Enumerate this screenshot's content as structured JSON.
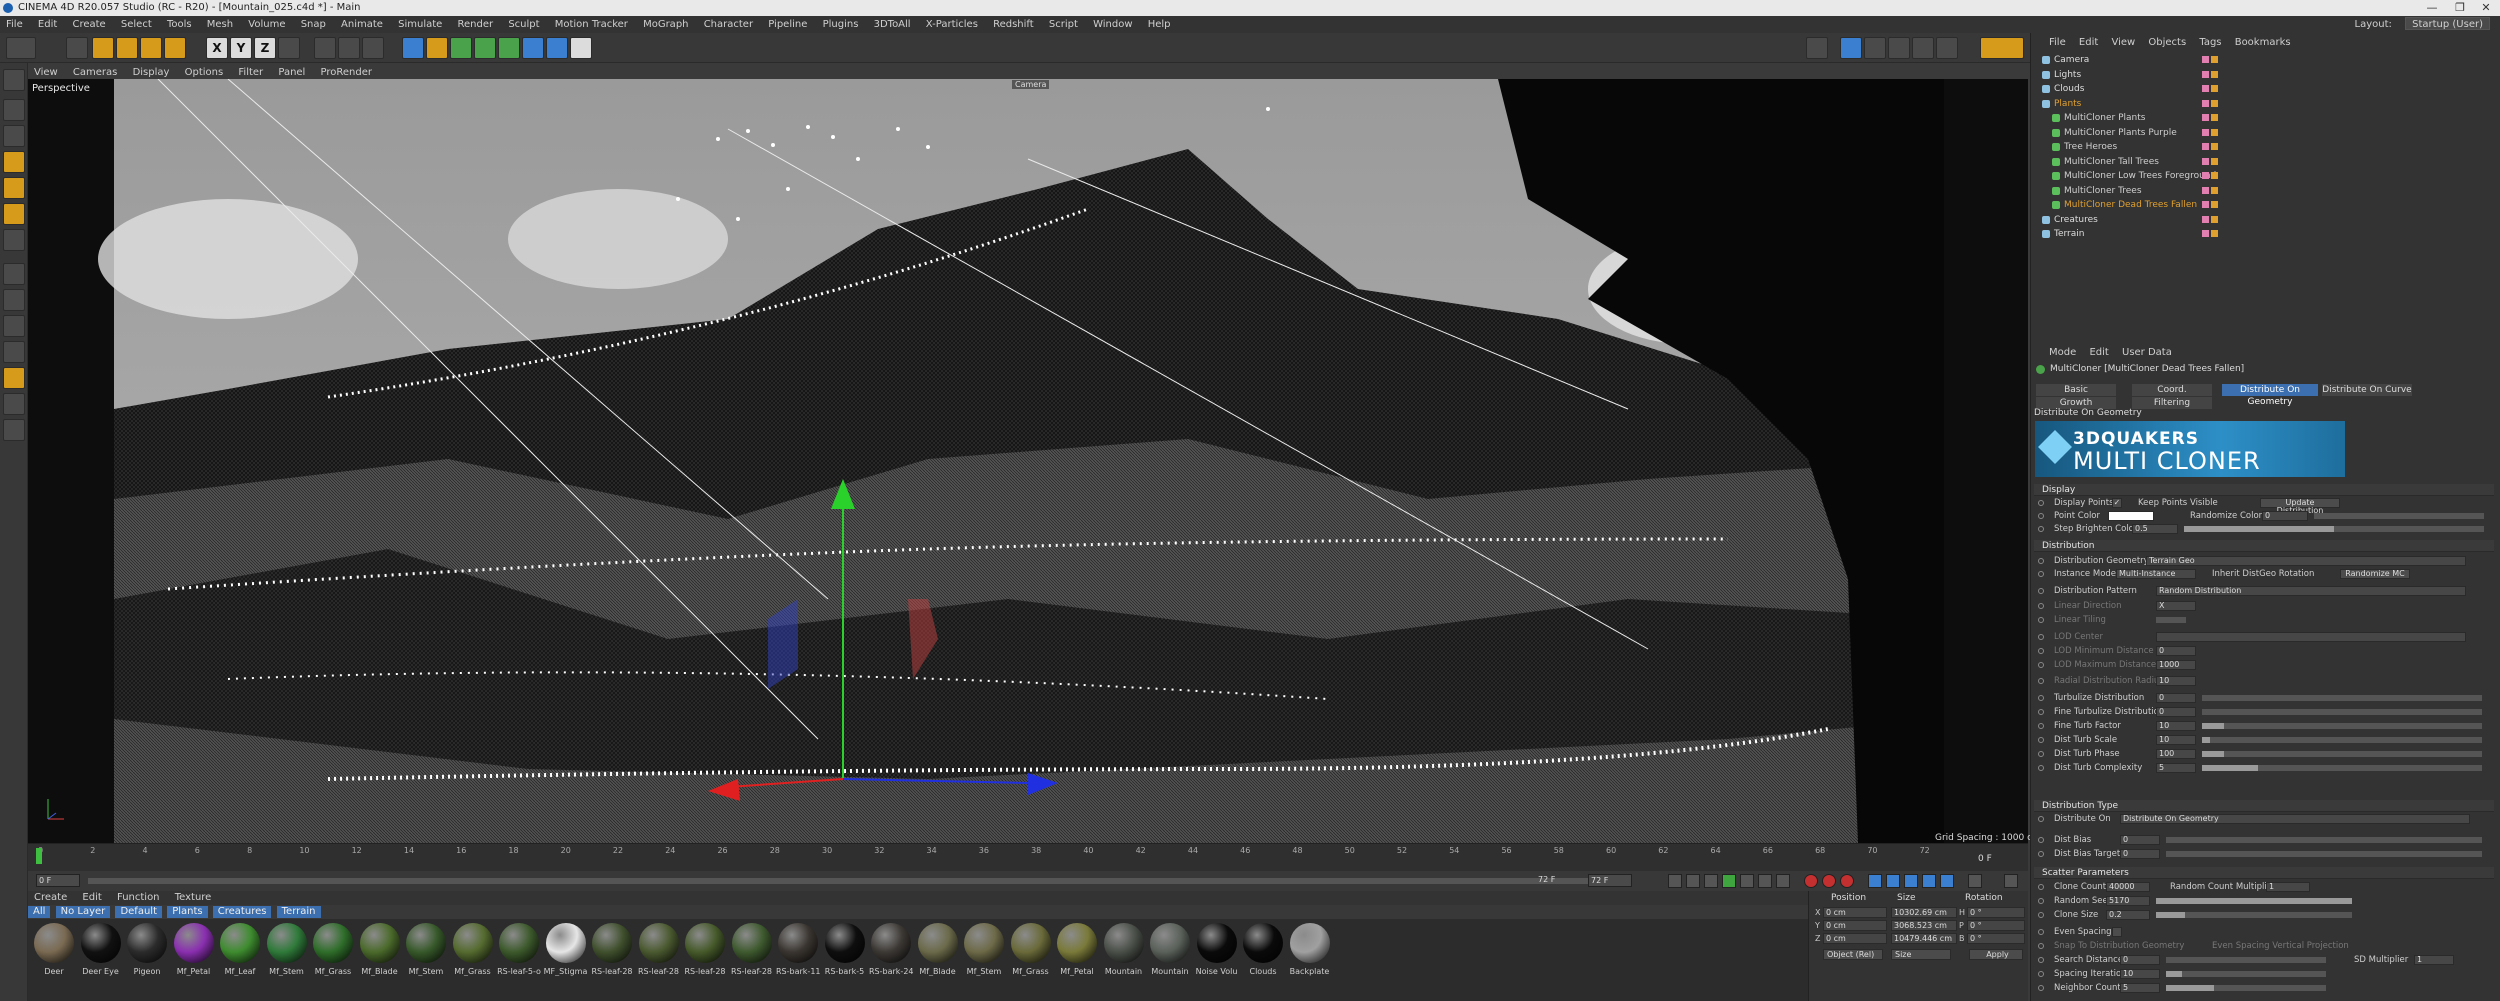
{
  "window": {
    "title": "CINEMA 4D R20.057 Studio (RC - R20) - [Mountain_025.c4d *] - Main",
    "min": "—",
    "max": "❐",
    "close": "✕"
  },
  "menubar": [
    "File",
    "Edit",
    "Create",
    "Select",
    "Tools",
    "Mesh",
    "Volume",
    "Snap",
    "Animate",
    "Simulate",
    "Render",
    "Sculpt",
    "Motion Tracker",
    "MoGraph",
    "Character",
    "Pipeline",
    "Plugins",
    "3DToAll",
    "X-Particles",
    "Redshift",
    "Script",
    "Window",
    "Help"
  ],
  "layout": {
    "label": "Layout:",
    "value": "Startup (User)"
  },
  "toolbar": {
    "axes": [
      "X",
      "Y",
      "Z"
    ]
  },
  "viewport": {
    "menu": [
      "View",
      "Cameras",
      "Display",
      "Options",
      "Filter",
      "Panel",
      "ProRender"
    ],
    "label": "Perspective",
    "grid_spacing": "Grid Spacing : 1000 cm",
    "camera_tag": "Camera"
  },
  "timeline": {
    "ticks": [
      "0",
      "2",
      "4",
      "6",
      "8",
      "10",
      "12",
      "14",
      "16",
      "18",
      "20",
      "22",
      "24",
      "26",
      "28",
      "30",
      "32",
      "34",
      "36",
      "38",
      "40",
      "42",
      "44",
      "46",
      "48",
      "50",
      "52",
      "54",
      "56",
      "58",
      "60",
      "62",
      "64",
      "66",
      "68",
      "70",
      "72"
    ],
    "current_frame": "0 F",
    "start_field": "0 F",
    "end_field": "72 F",
    "end_field2": "72 F",
    "frame_right": "0 F"
  },
  "material": {
    "menu": [
      "Create",
      "Edit",
      "Function",
      "Texture"
    ],
    "filters": [
      {
        "label": "All",
        "selected": true
      },
      {
        "label": "No Layer",
        "selected": true
      },
      {
        "label": "Default",
        "selected": true
      },
      {
        "label": "Plants",
        "selected": true
      },
      {
        "label": "Creatures",
        "selected": true
      },
      {
        "label": "Terrain",
        "selected": true
      }
    ],
    "items": [
      {
        "name": "Deer",
        "color": "#7a6a52"
      },
      {
        "name": "Deer Eye",
        "color": "#111111"
      },
      {
        "name": "Pigeon",
        "color": "#2b2b2b"
      },
      {
        "name": "Mf_Petal",
        "color": "#8a2fb0"
      },
      {
        "name": "Mf_Leaf",
        "color": "#3e8c2f"
      },
      {
        "name": "Mf_Stem",
        "color": "#2f7a3a"
      },
      {
        "name": "Mf_Grass",
        "color": "#2f6e2a"
      },
      {
        "name": "Mf_Blade",
        "color": "#4b6a2b"
      },
      {
        "name": "Mf_Stem",
        "color": "#37592a"
      },
      {
        "name": "Mf_Grass",
        "color": "#556b2f"
      },
      {
        "name": "RS-leaf-5-o",
        "color": "#3d5a2c"
      },
      {
        "name": "MF_Stigma",
        "color": "#e6e6e6"
      },
      {
        "name": "RS-leaf-28",
        "color": "#40502d"
      },
      {
        "name": "RS-leaf-28",
        "color": "#4b5a30"
      },
      {
        "name": "RS-leaf-28",
        "color": "#465a2a"
      },
      {
        "name": "RS-leaf-28",
        "color": "#3f5a2f"
      },
      {
        "name": "RS-bark-11",
        "color": "#3a3530"
      },
      {
        "name": "RS-bark-5",
        "color": "#0e0e0e"
      },
      {
        "name": "RS-bark-24",
        "color": "#3c3834"
      },
      {
        "name": "Mf_Blade",
        "color": "#6b6a4a"
      },
      {
        "name": "Mf_Stem",
        "color": "#6d6a48"
      },
      {
        "name": "Mf_Grass",
        "color": "#6a6a3a"
      },
      {
        "name": "Mf_Petal",
        "color": "#7a7a3a"
      },
      {
        "name": "Mountain",
        "color": "#4a4f48"
      },
      {
        "name": "Mountain",
        "color": "#5a605a"
      },
      {
        "name": "Noise Volu",
        "color": "#0a0a0a"
      },
      {
        "name": "Clouds",
        "color": "#0a0a0a"
      },
      {
        "name": "Backplate",
        "color": "#a0a0a0"
      }
    ]
  },
  "coords": {
    "headers": [
      "Position",
      "Size",
      "Rotation"
    ],
    "rows": [
      {
        "axis": "X",
        "pos": "0 cm",
        "size": "10302.69 cm",
        "rot_axis": "H",
        "rot": "0 °"
      },
      {
        "axis": "Y",
        "pos": "0 cm",
        "size": "3068.523 cm",
        "rot_axis": "P",
        "rot": "0 °"
      },
      {
        "axis": "Z",
        "pos": "0 cm",
        "size": "10479.446 cm",
        "rot_axis": "B",
        "rot": "0 °"
      }
    ],
    "mode": "Object (Rel)",
    "size_mode": "Size",
    "apply": "Apply"
  },
  "objects": {
    "menu": [
      "File",
      "Edit",
      "View",
      "Objects",
      "Tags",
      "Bookmarks"
    ],
    "items": [
      {
        "name": "Camera",
        "indent": 0,
        "color": "#dddddd",
        "highlight": false
      },
      {
        "name": "Lights",
        "indent": 0,
        "color": "#dddddd",
        "highlight": false
      },
      {
        "name": "Clouds",
        "indent": 0,
        "color": "#dddddd",
        "highlight": false
      },
      {
        "name": "Plants",
        "indent": 0,
        "color": "#e0a030",
        "highlight": true
      },
      {
        "name": "MultiCloner Plants",
        "indent": 1,
        "color": "#cfcfcf",
        "highlight": false
      },
      {
        "name": "MultiCloner Plants Purple",
        "indent": 1,
        "color": "#cfcfcf",
        "highlight": false
      },
      {
        "name": "Tree Heroes",
        "indent": 1,
        "color": "#cfcfcf",
        "highlight": false
      },
      {
        "name": "MultiCloner Tall Trees",
        "indent": 1,
        "color": "#cfcfcf",
        "highlight": false
      },
      {
        "name": "MultiCloner Low Trees Foreground",
        "indent": 1,
        "color": "#cfcfcf",
        "highlight": false
      },
      {
        "name": "MultiCloner Trees",
        "indent": 1,
        "color": "#cfcfcf",
        "highlight": false
      },
      {
        "name": "MultiCloner Dead Trees Fallen",
        "indent": 1,
        "color": "#e0a030",
        "highlight": true
      },
      {
        "name": "Creatures",
        "indent": 0,
        "color": "#dddddd",
        "highlight": false
      },
      {
        "name": "Terrain",
        "indent": 0,
        "color": "#dddddd",
        "highlight": false
      }
    ]
  },
  "attributes": {
    "menu": [
      "Mode",
      "Edit",
      "User Data"
    ],
    "title": "MultiCloner [MultiCloner Dead Trees Fallen]",
    "tabs_row1": [
      "Basic",
      "Coord.",
      "Distribute On Geometry",
      "Distribute On Curve"
    ],
    "tabs_row2": [
      "Growth",
      "Filtering"
    ],
    "selected_tab": "Distribute On Geometry",
    "section_label": "Distribute On Geometry",
    "logo_line1": "3DQUAKERS",
    "logo_line2": "MULTI CLONER",
    "display_header": "Display",
    "display_points": "Display Points",
    "keep_points": "Keep Points Visible",
    "update_btn": "Update Distribution",
    "point_color": "Point Color",
    "randomize_color": "Randomize Color",
    "randomize_value": "0",
    "step_brighten": "Step Brighten Color",
    "step_brighten_value": "0.5",
    "distribution_header": "Distribution",
    "dist_geometry": "Distribution Geometry",
    "dist_geometry_value": "Terrain Geo",
    "instance_mode": "Instance Mode",
    "instance_mode_value": "Multi-Instance",
    "inherit_rot": "Inherit DistGeo Rotation",
    "randomize_mc": "Randomize MC",
    "dist_pattern": "Distribution Pattern",
    "dist_pattern_value": "Random Distribution",
    "linear_direction": "Linear Direction",
    "linear_direction_value": "X",
    "linear_tiling": "Linear Tiling",
    "lod_center": "LOD Center",
    "lod_min": "LOD Minimum Distance",
    "lod_min_value": "0",
    "lod_max": "LOD Maximum Distance",
    "lod_max_value": "1000",
    "radial_radius": "Radial Distribution Radius",
    "radial_radius_value": "10",
    "turbulize": "Turbulize Distribution",
    "turbulize_value": "0",
    "fine_turb": "Fine Turbulize Distribution",
    "fine_turb_value": "0",
    "fine_turb_factor": "Fine Turb Factor",
    "fine_turb_factor_value": "10",
    "dist_turb_scale": "Dist Turb Scale",
    "dist_turb_scale_value": "10",
    "dist_turb_phase": "Dist Turb Phase",
    "dist_turb_phase_value": "100",
    "dist_turb_complexity": "Dist Turb Complexity",
    "dist_turb_complexity_value": "5",
    "dist_type_header": "Distribution Type",
    "distribute_on": "Distribute On",
    "distribute_on_value": "Distribute On Geometry",
    "dist_bias": "Dist Bias",
    "dist_bias_value": "0",
    "dist_bias_target": "Dist Bias Target",
    "dist_bias_target_value": "0",
    "scatter_header": "Scatter Parameters",
    "clone_count": "Clone Count",
    "clone_count_value": "40000",
    "random_count_mult": "Random Count Multiplier",
    "random_count_mult_value": "1",
    "random_seed": "Random Seed",
    "random_seed_value": "5170",
    "clone_size": "Clone Size",
    "clone_size_value": "0.2",
    "even_spacing": "Even Spacing",
    "snap_dist": "Snap To Distribution Geometry",
    "even_spacing_vertical": "Even Spacing Vertical Projection",
    "search_distance": "Search Distance",
    "search_distance_value": "0",
    "sd_multiplier": "SD Multiplier",
    "sd_multiplier_value": "1",
    "spacing_iterations": "Spacing Iterations",
    "spacing_iterations_value": "10",
    "neighbor_count": "Neighbor Count",
    "neighbor_count_value": "5"
  }
}
